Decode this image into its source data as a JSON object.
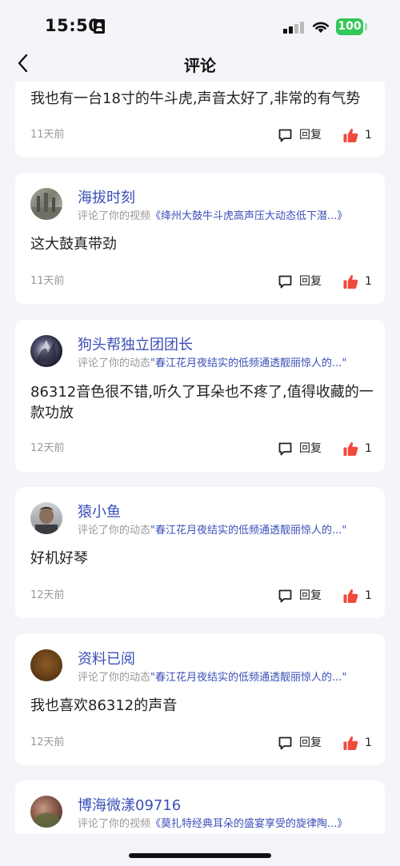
{
  "status_bar": {
    "time": "15:50",
    "battery": "100",
    "colors": {
      "battery": "#34c759"
    }
  },
  "header": {
    "title": "评论",
    "back_icon": "chevron-left-icon"
  },
  "icons": {
    "reply": "comment-bubble-icon",
    "like": "thumbs-up-icon"
  },
  "labels": {
    "reply": "回复"
  },
  "colors": {
    "link": "#3a4fb8",
    "like": "#f04a3e",
    "muted": "#999999"
  },
  "comments": [
    {
      "text": "我也有一台18寸的牛斗虎,声音太好了,非常的有气势",
      "time": "11天前",
      "likes": "1"
    },
    {
      "user": "海拔时刻",
      "action": "评论了你的视频",
      "target": "《绛州大鼓牛斗虎高声压大动态低下潜...》",
      "text": "这大鼓真带劲",
      "time": "11天前",
      "likes": "1"
    },
    {
      "user": "狗头帮独立团团长",
      "action": "评论了你的动态",
      "target": "\"春江花月夜结实的低频通透靓丽惊人的...\"",
      "text": "86312音色很不错,听久了耳朵也不疼了,值得收藏的一款功放",
      "time": "12天前",
      "likes": "1"
    },
    {
      "user": "猿小鱼",
      "action": "评论了你的动态",
      "target": "\"春江花月夜结实的低频通透靓丽惊人的...\"",
      "text": "好机好琴",
      "time": "12天前",
      "likes": "1"
    },
    {
      "user": "资料已阅",
      "action": "评论了你的动态",
      "target": "\"春江花月夜结实的低频通透靓丽惊人的...\"",
      "text": "我也喜欢86312的声音",
      "time": "12天前",
      "likes": "1"
    },
    {
      "user": "博海微漾09716",
      "action": "评论了你的视频",
      "target": "《莫扎特经典耳朵的盛宴享受的旋律陶...》"
    }
  ]
}
